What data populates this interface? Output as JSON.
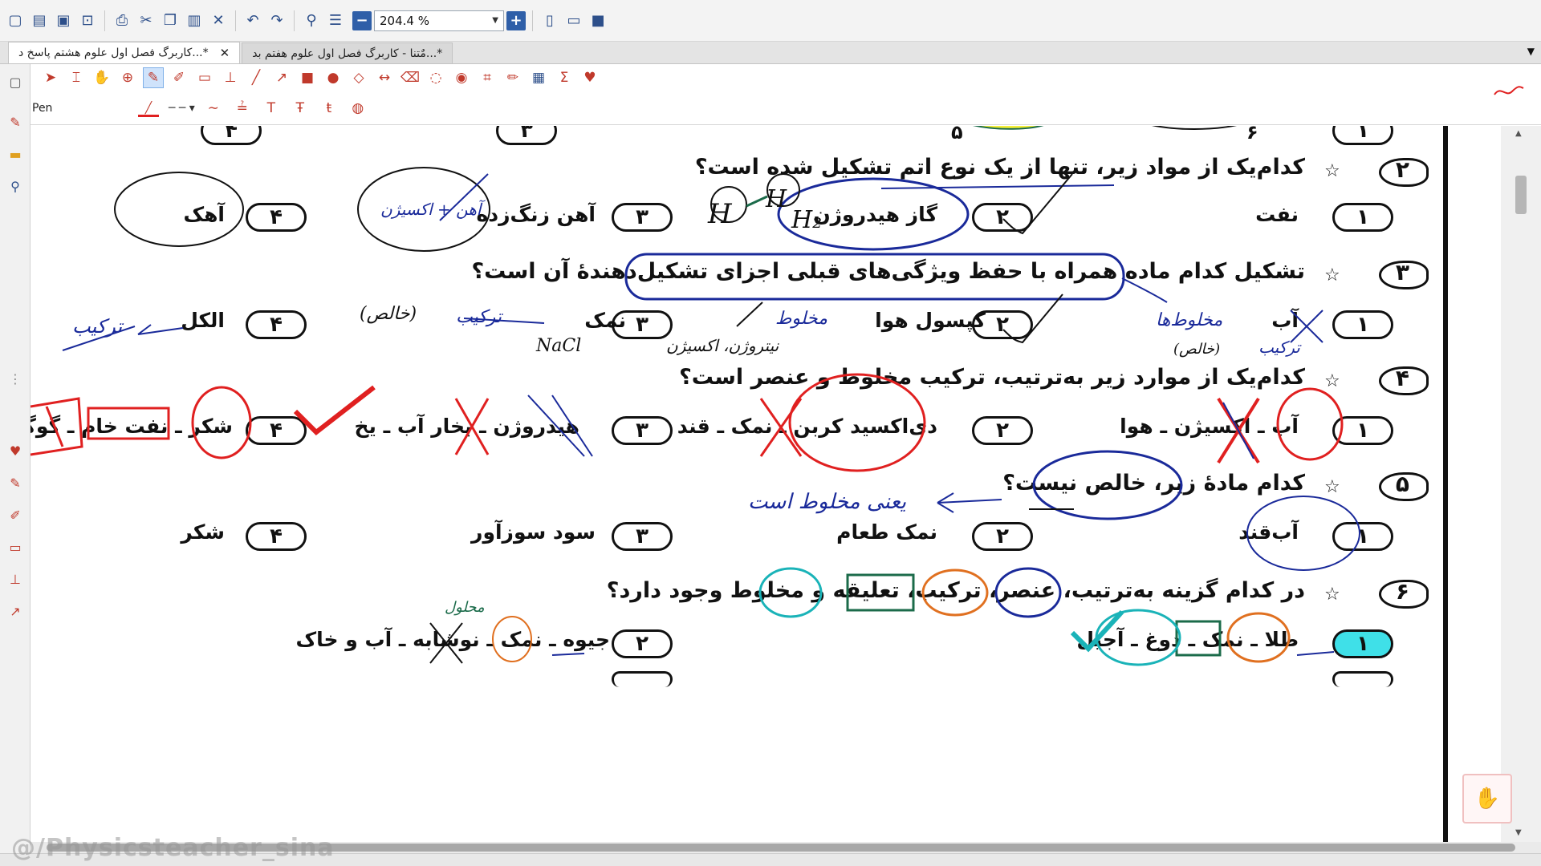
{
  "app": {
    "zoom": "204.4 %",
    "tool_label": "Pen",
    "watermark": "@/Physicsteacher_sina"
  },
  "tabs": [
    {
      "label": "کاربرگ فصل اول علوم هشتم پاسخ د...*",
      "active": true
    },
    {
      "label": "مٌتنا - کاربرگ فصل اول علوم هفتم بد...*",
      "active": false
    }
  ],
  "toolbar_icons": [
    "new-icon",
    "open-icon",
    "save-icon",
    "save-as-icon",
    "print-icon",
    "cut-icon",
    "copy-icon",
    "paste-icon",
    "delete-icon",
    "undo-icon",
    "redo-icon",
    "find-icon",
    "settings-icon"
  ],
  "colors": {
    "accent": "#2f5fa8",
    "ink_blue": "#1a2a9a",
    "ink_red": "#e02020",
    "ink_teal": "#1ab3b8",
    "ink_orange": "#e07020",
    "ink_green": "#1b6b4a",
    "highlight": "#f6f03a"
  },
  "top_row": {
    "opt4": "۳",
    "opt3": "۴",
    "opt2": "۵",
    "opt1": "۶"
  },
  "questions": [
    {
      "num": "۲",
      "text": "کدام‌یک از مواد زیر، تنها از یک نوع اتم تشکیل شده است؟",
      "options": [
        {
          "n": "۱",
          "text": "نفت"
        },
        {
          "n": "۲",
          "text": "گاز هیدروژن"
        },
        {
          "n": "۳",
          "text": "آهن زنگ‌زده"
        },
        {
          "n": "۴",
          "text": "آهک"
        }
      ]
    },
    {
      "num": "۳",
      "text": "تشکیل کدام ماده همراه با حفظ ویژگی‌های قبلی اجزای تشکیل‌دهندۀ آن است؟",
      "options": [
        {
          "n": "۱",
          "text": "آب"
        },
        {
          "n": "۲",
          "text": "کپسول هوا"
        },
        {
          "n": "۳",
          "text": "نمک"
        },
        {
          "n": "۴",
          "text": "الکل"
        }
      ]
    },
    {
      "num": "۴",
      "text": "کدام‌یک از موارد زیر به‌ترتیب، ترکیب مخلوط و عنصر است؟",
      "options": [
        {
          "n": "۱",
          "text": "آب ـ اکسیژن ـ هوا"
        },
        {
          "n": "۲",
          "text": "دی‌اکسید کربن ـ نمک ـ قند"
        },
        {
          "n": "۳",
          "text": "هیدروژن ـ بخار آب ـ یخ"
        },
        {
          "n": "۴",
          "text": "شکر ـ نفت خام ـ گوگرد"
        }
      ]
    },
    {
      "num": "۵",
      "text": "کدام مادۀ زیر، خالص نیست؟",
      "options": [
        {
          "n": "۱",
          "text": "آب‌قند"
        },
        {
          "n": "۲",
          "text": "نمک طعام"
        },
        {
          "n": "۳",
          "text": "سود سوزآور"
        },
        {
          "n": "۴",
          "text": "شکر"
        }
      ]
    },
    {
      "num": "۶",
      "text": "در کدام گزینه به‌ترتیب، عنصر، ترکیب، تعلیقه و مخلوط وجود دارد؟",
      "options": [
        {
          "n": "۱",
          "text": "طلا ـ نمک ـ دوغ ـ آجیل"
        },
        {
          "n": "۲",
          "text": "جیوه ـ نمک ـ نوشابه ـ آب و خاک"
        }
      ]
    }
  ],
  "handwriting": {
    "h2": "H₂",
    "h": "H",
    "rust": "آهن + اکسیژن",
    "mixtures": "مخلوط‌ها",
    "pure": "(خالص)",
    "tarkib": "ترکیب",
    "nacl": "NaCl",
    "makhlut": "مخلوط",
    "ox": "نیتروژن، اکسیژن",
    "ya_makhlut": "یعنی مخلوط است",
    "tarkib2": "ترکیب",
    "pure2": "(خالص)",
    "mahlol": "محلول"
  }
}
